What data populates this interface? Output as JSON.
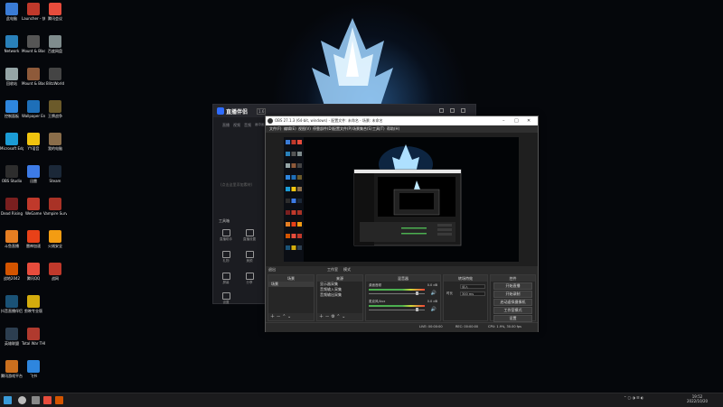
{
  "desktop_icons": [
    {
      "label": "此电脑",
      "color": "#3a7bd5"
    },
    {
      "label": "Launcher - 快捷方式",
      "color": "#c0392b"
    },
    {
      "label": "腾讯会议",
      "color": "#e74c3c"
    },
    {
      "label": "Network",
      "color": "#2980b9"
    },
    {
      "label": "Mount & Blade II ...",
      "color": "#555555"
    },
    {
      "label": "百度网盘",
      "color": "#7f8c8d"
    },
    {
      "label": "回收站",
      "color": "#95a5a6"
    },
    {
      "label": "Mount & Blade ...",
      "color": "#8e5a3a"
    },
    {
      "label": "BlitzWorld",
      "color": "#444444"
    },
    {
      "label": "控制面板",
      "color": "#2e86de"
    },
    {
      "label": "Wallpaper Engine",
      "color": "#1e6fb8"
    },
    {
      "label": "王牌战争",
      "color": "#6b5a2a"
    },
    {
      "label": "Microsoft Edge",
      "color": "#1b9cd6"
    },
    {
      "label": "YY语音",
      "color": "#f1c40f"
    },
    {
      "label": "我的电脑",
      "color": "#8a6d4a"
    },
    {
      "label": "OBS Studio",
      "color": "#2d2d2d"
    },
    {
      "label": "迅雷",
      "color": "#3d7be6"
    },
    {
      "label": "Steam",
      "color": "#1b2838"
    },
    {
      "label": "Dead Rising",
      "color": "#7a1f1f"
    },
    {
      "label": "WeGame",
      "color": "#c0392b"
    },
    {
      "label": "Vampire Survivors",
      "color": "#a93226"
    },
    {
      "label": "斗鱼直播",
      "color": "#e67e22"
    },
    {
      "label": "雷神加速",
      "color": "#e84118"
    },
    {
      "label": "火绒安全",
      "color": "#f39c12"
    },
    {
      "label": "战地2042",
      "color": "#d35400"
    },
    {
      "label": "腾讯QQ",
      "color": "#e74c3c"
    },
    {
      "label": "战网",
      "color": "#c0392b"
    },
    {
      "label": "抖音直播伴侣",
      "color": "#1a5276"
    },
    {
      "label": "剪映专业版",
      "color": "#d4ac0d"
    },
    {
      "label": "英雄联盟",
      "color": "#2c3e50"
    },
    {
      "label": "Total War THREE KI...",
      "color": "#b03a2e"
    },
    {
      "label": "腾讯游戏平台",
      "color": "#ca6f1e"
    },
    {
      "label": "飞书",
      "color": "#2e86de"
    }
  ],
  "taskbar": {
    "time": "19:52",
    "date": "2022/10/20",
    "pinned": [
      {
        "name": "windows-start-icon",
        "color": "#3a9bd9"
      },
      {
        "name": "search-icon",
        "color": "#bbbbbb"
      },
      {
        "name": "obs-taskbar-icon",
        "color": "#888888"
      },
      {
        "name": "douyin-taskbar-icon",
        "color": "#e74c3c"
      },
      {
        "name": "wegame-taskbar-icon",
        "color": "#d35400"
      }
    ]
  },
  "zb": {
    "app_name": "直播伴侣",
    "version": "1.6",
    "tabs": [
      "直播",
      "视频",
      "音频",
      "画中画"
    ],
    "tip": "(点击这里添加素材)",
    "tools_title": "工具箱",
    "tools": [
      "直播助手",
      "直播设置",
      "礼物",
      "美颜",
      "屏幕",
      "分享",
      "设置"
    ],
    "bottom_label": "开播"
  },
  "obs": {
    "title": "OBS 27.1.3 (64-bit, windows) - 配置文件: 未命名 - 场景: 未命名",
    "menu": [
      "文件(F)",
      "编辑(E)",
      "视图(V)",
      "停靠部件(D)",
      "配置文件(P)",
      "场景集合(S)",
      "工具(T)",
      "帮助(H)"
    ],
    "mode_label": "退出",
    "mode_buttons": [
      "工作室",
      "模式"
    ],
    "docks": {
      "scenes": {
        "header": "场景",
        "items": [
          "场景"
        ]
      },
      "sources": {
        "header": "来源",
        "items": [
          "显示器采集",
          "音频输入采集",
          "音频输出采集"
        ]
      },
      "mixer": {
        "header": "混音器",
        "channels": [
          {
            "name": "桌面音频",
            "db": "0.0 dB",
            "level": 0.85
          },
          {
            "name": "麦克风/Aux",
            "db": "0.0 dB",
            "level": 0.85
          }
        ]
      },
      "transitions": {
        "header": "转场特效",
        "effect_label": "淡入",
        "duration_label": "时长",
        "duration_value": "300 ms"
      },
      "controls": {
        "header": "控件",
        "buttons": [
          "开始直播",
          "开始录制",
          "启动虚拟摄像机",
          "工作室模式",
          "设置",
          "退出"
        ]
      }
    },
    "status": {
      "live": "LIVE: 00:00:00",
      "rec": "REC: 00:00:00",
      "cpu": "CPU: 1.9%, 30.00 fps"
    }
  }
}
